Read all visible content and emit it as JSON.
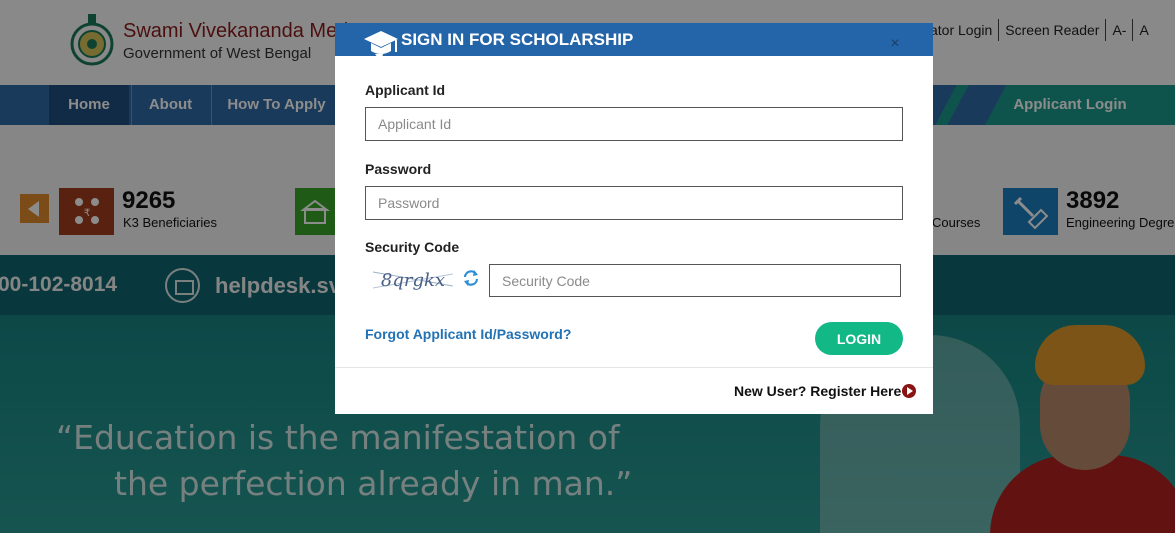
{
  "site": {
    "title": "Swami Vivekananda Meri",
    "subtitle": "Government of West Bengal"
  },
  "toplinks": [
    "ator Login",
    "Screen Reader",
    "A-",
    "A"
  ],
  "nav": {
    "home": "Home",
    "about": "About",
    "how_to_apply": "How To Apply",
    "applicant_login": "Applicant Login"
  },
  "stats": [
    {
      "number": "9265",
      "label": "K3 Beneficiaries",
      "icon": "beneficiaries-icon",
      "color": "#a23e1e"
    },
    {
      "number": "",
      "label": "",
      "icon": "school-icon",
      "color": "#3aa62a"
    },
    {
      "number": "",
      "label": "Courses",
      "icon": "",
      "color": ""
    },
    {
      "number": "3892",
      "label": "Engineering Degre",
      "icon": "engineering-icon",
      "color": "#1e7ec2"
    }
  ],
  "banner": {
    "phone": "00-102-8014",
    "helpdesk": "helpdesk.sv",
    "quote_line1": "“Education is the manifestation of",
    "quote_line2": "the perfection already in man.”"
  },
  "modal": {
    "title": "SIGN IN FOR SCHOLARSHIP",
    "close": "×",
    "applicant_id_label": "Applicant Id",
    "applicant_id_placeholder": "Applicant Id",
    "applicant_id_value": "",
    "password_label": "Password",
    "password_placeholder": "Password",
    "password_value": "",
    "security_code_label": "Security Code",
    "captcha_text": "8qrgkx",
    "security_code_placeholder": "Security Code",
    "security_code_value": "",
    "forgot_link": "Forgot Applicant Id/Password?",
    "login_button": "LOGIN",
    "register_text": "New User? Register Here"
  },
  "colors": {
    "modal_header": "#2365a8",
    "login_button": "#12b885",
    "link": "#2372b4",
    "nav": "#2e6aa6",
    "accent_teal": "#1c9a8a"
  }
}
